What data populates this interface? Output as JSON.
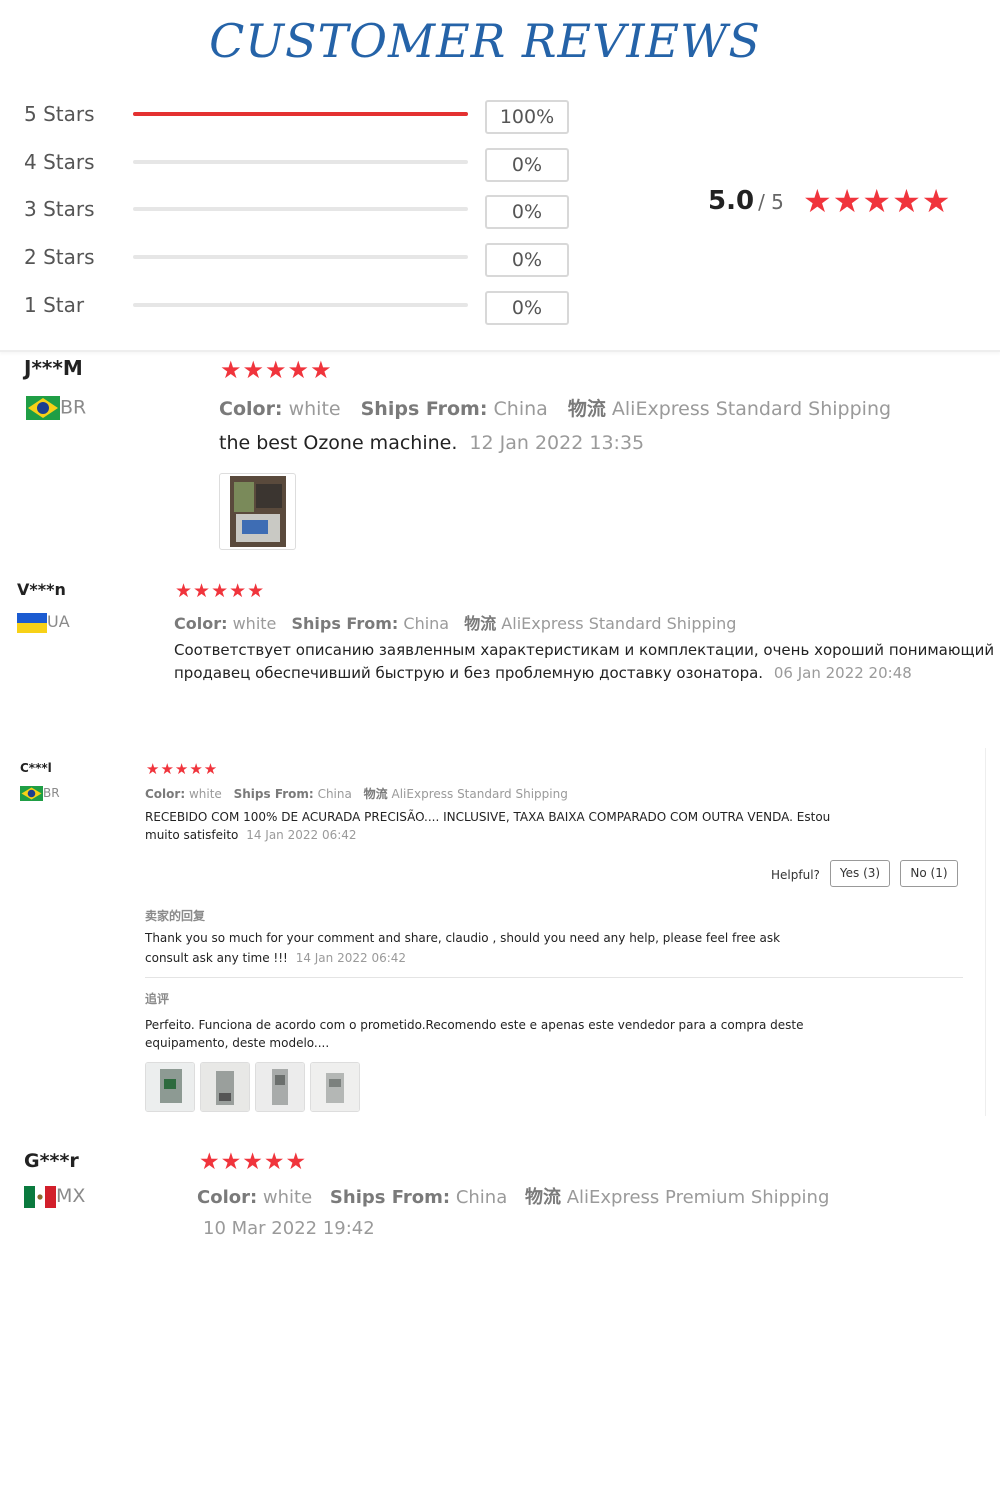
{
  "page_title": "CUSTOMER REVIEWS",
  "summary": {
    "rows": [
      {
        "label": "5 Stars",
        "percent_text": "100%",
        "fill": 1.0
      },
      {
        "label": "4 Stars",
        "percent_text": "0%",
        "fill": 0
      },
      {
        "label": "3 Stars",
        "percent_text": "0%",
        "fill": 0
      },
      {
        "label": "2 Stars",
        "percent_text": "0%",
        "fill": 0
      },
      {
        "label": "1 Star",
        "percent_text": "0%",
        "fill": 0
      }
    ],
    "score": "5.0",
    "score_of": "/ 5",
    "stars": "★★★★★",
    "star_rating": 5
  },
  "reviews": [
    {
      "user": "J***M",
      "country": "BR",
      "stars": "★★★★★",
      "color_label": "Color:",
      "color_value": "white",
      "ships_label": "Ships From:",
      "ships_value": "China",
      "logistics_label": "物流",
      "logistics_value": "AliExpress Standard Shipping",
      "text": "the best Ozone machine.",
      "date": "12 Jan 2022 13:35"
    },
    {
      "user": "V***n",
      "country": "UA",
      "stars": "★★★★★",
      "color_label": "Color:",
      "color_value": "white",
      "ships_label": "Ships From:",
      "ships_value": "China",
      "logistics_label": "物流",
      "logistics_value": "AliExpress Standard Shipping",
      "text_line1": "Соответствует описанию заявленным характеристикам и комплектации, очень хороший понимающий",
      "text_line2": "продавец обеспечивший быструю и без проблемную доставку озонатора.",
      "date": "06 Jan 2022 20:48"
    },
    {
      "user": "C***l",
      "country": "BR",
      "stars": "★★★★★",
      "color_label": "Color:",
      "color_value": "white",
      "ships_label": "Ships From:",
      "ships_value": "China",
      "logistics_label": "物流",
      "logistics_value": "AliExpress Standard Shipping",
      "text_line1": "RECEBIDO COM 100% DE ACURADA PRECISÃO.... INCLUSIVE, TAXA BAIXA COMPARADO COM OUTRA VENDA. Estou",
      "text_line2": "muito satisfeito",
      "date": "14 Jan 2022 06:42",
      "helpful_label": "Helpful?",
      "yes_label": "Yes (3)",
      "no_label": "No (1)",
      "seller_reply_label": "卖家的回复",
      "seller_reply_line1": "Thank you so much for your comment and share, claudio , should you need any help, please feel free ask",
      "seller_reply_line2": "consult ask any time !!!",
      "seller_reply_date": "14 Jan 2022 06:42",
      "followup_label": "追评",
      "followup_line1": "Perfeito. Funciona de acordo com o prometido.Recomendo este e apenas este vendedor para a compra deste",
      "followup_line2": "equipamento, deste modelo...."
    },
    {
      "user": "G***r",
      "country": "MX",
      "stars": "★★★★★",
      "color_label": "Color:",
      "color_value": "white",
      "ships_label": "Ships From:",
      "ships_value": "China",
      "logistics_label": "物流",
      "logistics_value": "AliExpress Premium Shipping",
      "date": "10 Mar 2022 19:42"
    }
  ],
  "colors": {
    "title": "#2563a8",
    "star": "#f0343c",
    "bar_fill": "#e43131",
    "meta": "#9a9a9a"
  }
}
